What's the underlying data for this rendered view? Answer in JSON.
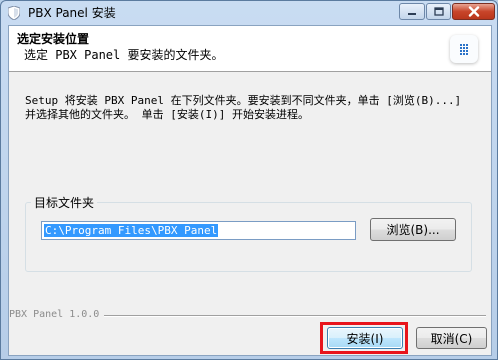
{
  "window": {
    "title": "PBX Panel 安装"
  },
  "header": {
    "title": "选定安装位置",
    "subtitle": "选定 PBX Panel 要安装的文件夹。"
  },
  "description": {
    "line1": "Setup 将安装 PBX Panel 在下列文件夹。要安装到不同文件夹，单击 [浏览(B)...]",
    "line2": "并选择其他的文件夹。 单击 [安装(I)] 开始安装进程。"
  },
  "destination": {
    "group_label": "目标文件夹",
    "path_value": "C:\\Program Files\\PBX Panel",
    "browse_label": "浏览(B)..."
  },
  "footer": {
    "branding": "PBX Panel 1.0.0",
    "install_label": "安装(I)",
    "cancel_label": "取消(C)"
  },
  "colors": {
    "highlight": "#e8141b",
    "selection": "#3399ff"
  },
  "icons": {
    "app": "shield-icon",
    "logo": "keypad-logo-icon",
    "minimize": "minimize-icon",
    "maximize": "maximize-icon",
    "close": "close-icon"
  }
}
